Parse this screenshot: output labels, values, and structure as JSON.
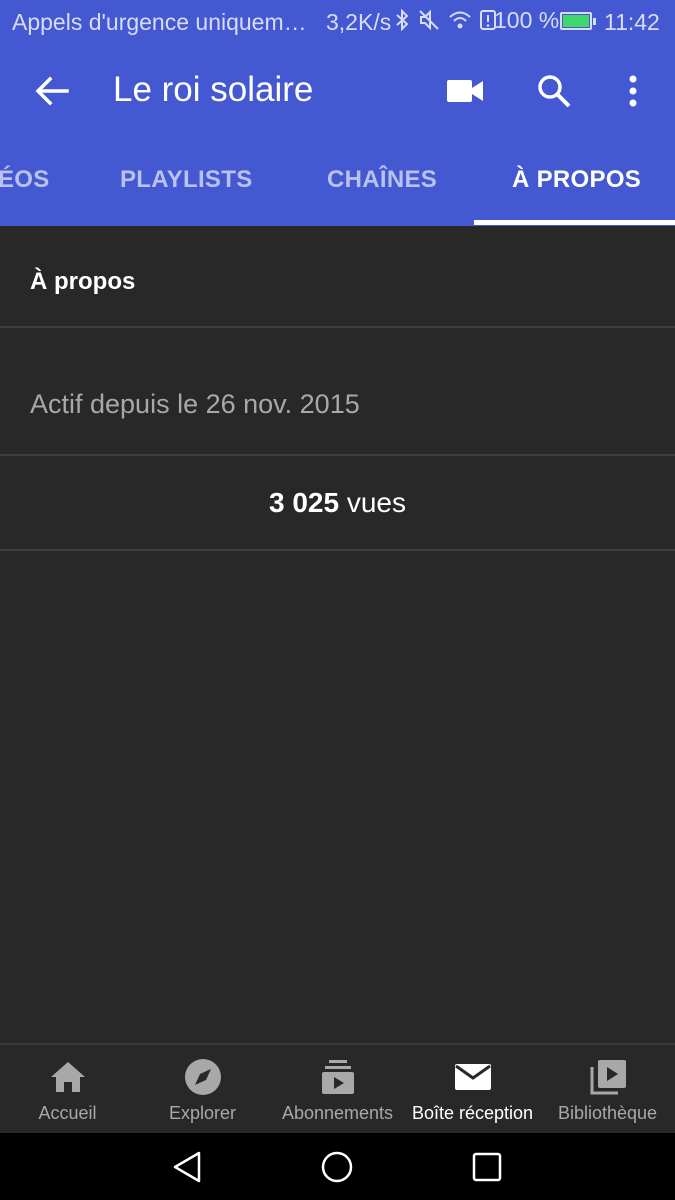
{
  "status_bar": {
    "carrier": "Appels d'urgence uniquem…",
    "speed": "3,2K/s",
    "battery_pct": "100 %",
    "time": "11:42",
    "icons": [
      "bluetooth-icon",
      "mute-icon",
      "wifi-icon",
      "alert-icon",
      "battery-icon"
    ]
  },
  "appbar": {
    "title": "Le roi solaire",
    "icons": [
      "back-arrow-icon",
      "video-camera-icon",
      "search-icon",
      "more-vert-icon"
    ]
  },
  "tabs": [
    {
      "label": "ÉOS",
      "active": false
    },
    {
      "label": "PLAYLISTS",
      "active": false
    },
    {
      "label": "CHAÎNES",
      "active": false
    },
    {
      "label": "À PROPOS",
      "active": true
    }
  ],
  "about": {
    "title": "À propos",
    "since": "Actif depuis le 26 nov. 2015",
    "views_count": "3 025",
    "views_unit": "vues"
  },
  "bottom_nav": [
    {
      "label": "Accueil",
      "icon": "home-icon",
      "active": false
    },
    {
      "label": "Explorer",
      "icon": "compass-icon",
      "active": false
    },
    {
      "label": "Abonnements",
      "icon": "subscriptions-icon",
      "active": false
    },
    {
      "label": "Boîte réception",
      "icon": "mail-icon",
      "active": true
    },
    {
      "label": "Bibliothèque",
      "icon": "library-icon",
      "active": false
    }
  ],
  "system_nav": [
    "back-triangle-icon",
    "home-circle-icon",
    "recents-square-icon"
  ],
  "colors": {
    "brand_blue": "#4458d2",
    "background": "#282828",
    "text_muted": "#a8a8a8"
  }
}
